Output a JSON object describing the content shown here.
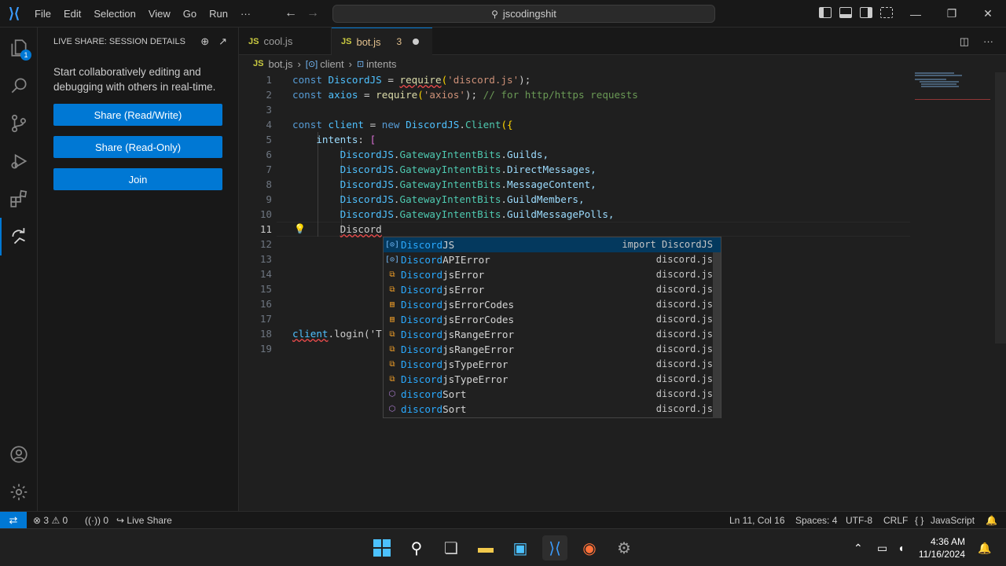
{
  "window": {
    "search": "jscodingshit",
    "menu": [
      "File",
      "Edit",
      "Selection",
      "View",
      "Go",
      "Run",
      "···"
    ]
  },
  "activity": {
    "explorer_badge": "1"
  },
  "sidebar": {
    "title": "LIVE SHARE: SESSION DETAILS",
    "description": "Start collaboratively editing and debugging with others in real-time.",
    "buttons": [
      "Share (Read/Write)",
      "Share (Read-Only)",
      "Join"
    ]
  },
  "tabs": [
    {
      "label": "cool.js",
      "prefix": "JS"
    },
    {
      "label": "bot.js",
      "prefix": "JS",
      "problems": "3"
    }
  ],
  "breadcrumb": {
    "prefix": "JS",
    "file": "bot.js",
    "symbol1": "client",
    "symbol2": "intents"
  },
  "editor": {
    "line_numbers": [
      "1",
      "2",
      "3",
      "4",
      "5",
      "6",
      "7",
      "8",
      "9",
      "10",
      "11",
      "12",
      "13",
      "14",
      "15",
      "16",
      "17",
      "18",
      "19"
    ],
    "current_line": "11",
    "typed": "Discord",
    "lines": {
      "l1_a": "const ",
      "l1_b": "DiscordJS",
      "l1_c": " = ",
      "l1_d": "require",
      "l1_e": "(",
      "l1_f": "'discord.js'",
      "l1_g": ");",
      "l2_a": "const ",
      "l2_b": "axios",
      "l2_c": " = ",
      "l2_d": "require",
      "l2_e": "(",
      "l2_f": "'axios'",
      "l2_g": "); ",
      "l2_h": "// for http/https requests",
      "l4_a": "const ",
      "l4_b": "client",
      "l4_c": " = ",
      "l4_d": "new ",
      "l4_e": "DiscordJS",
      "l4_f": ".",
      "l4_g": "Client",
      "l4_h": "({",
      "l5_a": "intents",
      "l5_b": ": ",
      "l5_c": "[",
      "intents": [
        "Guilds,",
        "DirectMessages,",
        "MessageContent,",
        "GuildMembers,",
        "GuildMessagePolls,"
      ],
      "intent_obj": "DiscordJS",
      "intent_mid": "GatewayIntentBits",
      "l18_a": "client",
      "l18_b": ".login('T"
    }
  },
  "suggest": [
    {
      "match": "Discord",
      "rest": "JS",
      "detail": "import DiscordJS",
      "kind": "variable",
      "icon": "variable-icon"
    },
    {
      "match": "Discord",
      "rest": "APIError",
      "detail": "discord.js",
      "kind": "variable",
      "icon": "variable-icon"
    },
    {
      "match": "Discord",
      "rest": "jsError",
      "detail": "discord.js",
      "kind": "class",
      "icon": "class-icon"
    },
    {
      "match": "Discord",
      "rest": "jsError",
      "detail": "discord.js",
      "kind": "class",
      "icon": "class-icon"
    },
    {
      "match": "Discord",
      "rest": "jsErrorCodes",
      "detail": "discord.js",
      "kind": "enum",
      "icon": "enum-icon"
    },
    {
      "match": "Discord",
      "rest": "jsErrorCodes",
      "detail": "discord.js",
      "kind": "enum",
      "icon": "enum-icon"
    },
    {
      "match": "Discord",
      "rest": "jsRangeError",
      "detail": "discord.js",
      "kind": "class",
      "icon": "class-icon"
    },
    {
      "match": "Discord",
      "rest": "jsRangeError",
      "detail": "discord.js",
      "kind": "class",
      "icon": "class-icon"
    },
    {
      "match": "Discord",
      "rest": "jsTypeError",
      "detail": "discord.js",
      "kind": "class",
      "icon": "class-icon"
    },
    {
      "match": "Discord",
      "rest": "jsTypeError",
      "detail": "discord.js",
      "kind": "class",
      "icon": "class-icon"
    },
    {
      "match": "discord",
      "rest": "Sort",
      "detail": "discord.js",
      "kind": "module",
      "icon": "module-icon"
    },
    {
      "match": "discord",
      "rest": "Sort",
      "detail": "discord.js",
      "kind": "module",
      "icon": "module-icon"
    }
  ],
  "status": {
    "errors": "3",
    "warnings": "0",
    "ports": "0",
    "liveshare": "Live Share",
    "position": "Ln 11, Col 16",
    "spaces": "Spaces: 4",
    "encoding": "UTF-8",
    "eol": "CRLF",
    "braces": "{ }",
    "language": "JavaScript"
  },
  "taskbar": {
    "time": "4:36 AM",
    "date": "11/16/2024"
  },
  "colors": {
    "accent": "#0078d4",
    "match": "#2aaaff",
    "selection": "#04395e"
  }
}
